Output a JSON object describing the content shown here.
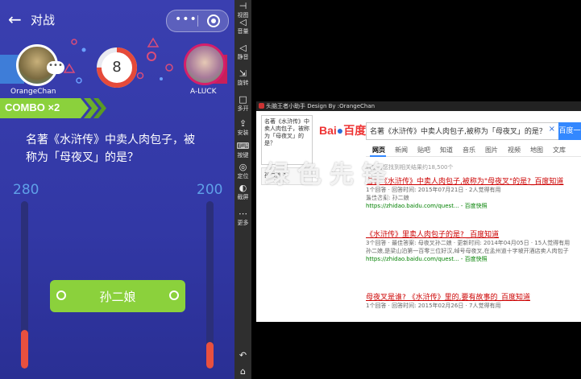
{
  "game": {
    "back_icon": "←",
    "title": "对战",
    "capsule_more": "•••",
    "left_player": "OrangeChan",
    "right_player": "A-LUCK",
    "timer": "8",
    "timer_fraction": 0.75,
    "combo": "COMBO ×2",
    "question": "名著《水浒传》中卖人肉包子，被称为「母夜叉」的是？",
    "left_score": "280",
    "right_score": "200",
    "left_bar_fraction": 0.23,
    "right_bar_fraction": 0.16,
    "answer": "孙二娘",
    "colors": {
      "combo": "#8bd13c",
      "answer": "#8bd13c",
      "bar": "#e9503f",
      "timer_ring": "#e54a3a"
    }
  },
  "sidebar": {
    "items": [
      {
        "icon": "⊣",
        "label": "视图"
      },
      {
        "icon": "◁",
        "label": "音量"
      },
      {
        "icon": "◁",
        "label": "静音"
      },
      {
        "icon": "⇲",
        "label": "旋转"
      },
      {
        "icon": "□",
        "label": "多开"
      },
      {
        "icon": "⇪",
        "label": "安装"
      },
      {
        "icon": "⌨",
        "label": "按键"
      },
      {
        "icon": "◎",
        "label": "定位"
      },
      {
        "icon": "◐",
        "label": "截屏"
      },
      {
        "icon": "⋯",
        "label": "更多"
      },
      {
        "icon": "↶",
        "label": ""
      },
      {
        "icon": "⌂",
        "label": ""
      }
    ]
  },
  "browser": {
    "window_title": "头脑王者小助手 Design By :OrangeChan",
    "thumb_text": "名著《水浒传》中卖人肉包子，被称为「母夜叉」的是？",
    "thumb2_text": "孙二娘 1",
    "logo_text": "Bai",
    "logo_paw": "du",
    "logo_cn": "百度",
    "search_query": "名著《水浒传》中卖人肉包子,被称为「母夜叉」的是？",
    "search_button": "百度一下",
    "tabs": [
      "网页",
      "新闻",
      "贴吧",
      "知道",
      "音乐",
      "图片",
      "视频",
      "地图",
      "文库"
    ],
    "result_count": "百度为您找到相关结果约18,500个",
    "results": [
      {
        "title": "名著《水浒传》中卖人肉包子,被称为\"母夜叉\"的是?_百度知道",
        "meta": "1个回答 · 回答时间: 2015年07月21日 · 2人觉得有用",
        "extra": "最佳答案: 孙二娘",
        "url": "https://zhidao.baidu.com/quest... - 百度快照"
      },
      {
        "title": "《水浒传》里卖人肉包子的是? _百度知道",
        "meta": "3个回答 · 最佳答案: 母夜叉孙二娘 · 更新时间: 2014年04月05日 · 15人觉得有用",
        "extra": "孙二娘,是梁山泊第一百零三位好汉,绰号母夜叉,在孟州道十字坡开酒店卖人肉包子",
        "url": "https://zhidao.baidu.com/quest... - 百度快照"
      },
      {
        "title": "母夜叉是谁? 《水浒传》里的,要有故事的_百度知道",
        "meta": "1个回答 · 回答时间: 2015年02月26日 · 7人觉得有用",
        "extra": "",
        "url": ""
      }
    ]
  },
  "watermark": {
    "text": "绿色先锋",
    "url": "www.greenxf.com"
  }
}
